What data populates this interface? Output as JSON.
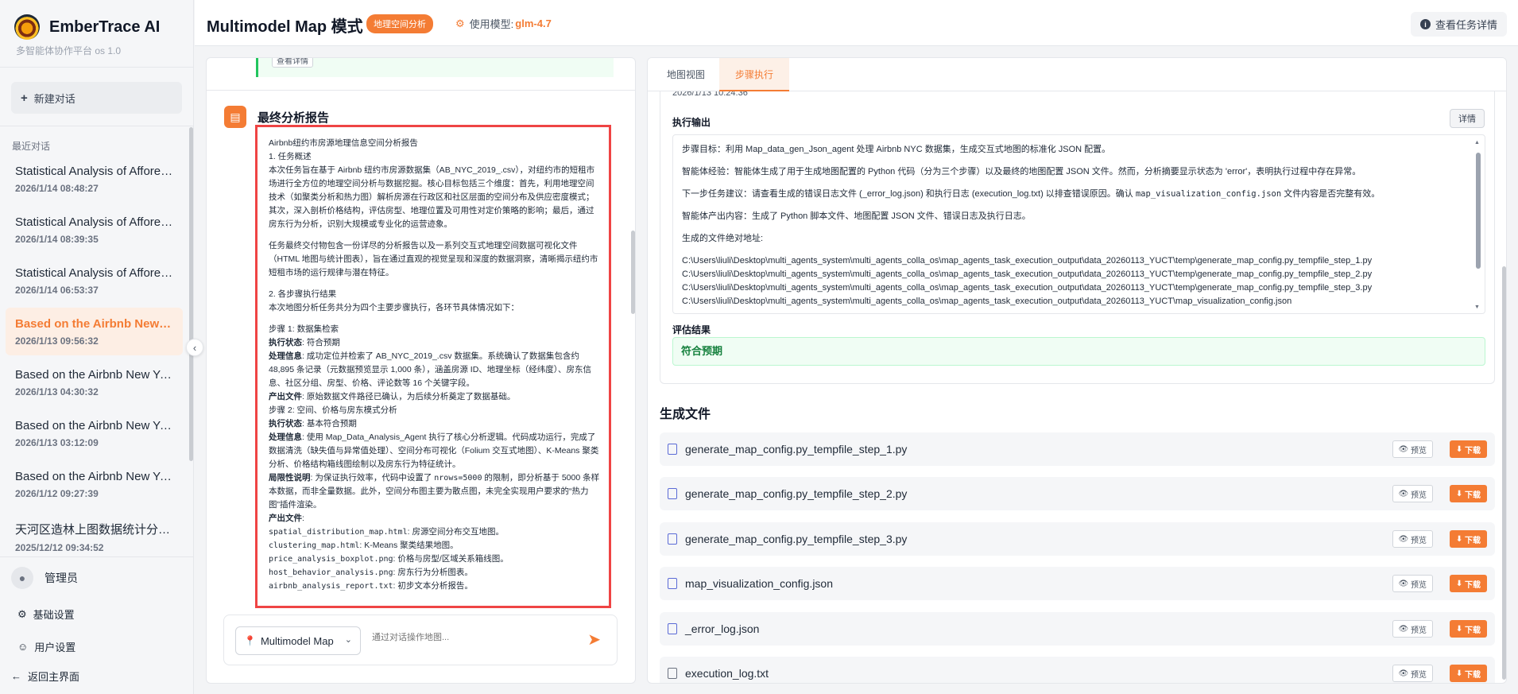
{
  "sidebar": {
    "brand_name": "EmberTrace AI",
    "brand_sub": "多智能体协作平台 os 1.0",
    "new_chat": "新建对话",
    "recent_label": "最近对话",
    "conversations": [
      {
        "title": "Statistical Analysis of Afforestation...",
        "time": "2026/1/14 08:48:27"
      },
      {
        "title": "Statistical Analysis of Afforestation...",
        "time": "2026/1/14 08:39:35"
      },
      {
        "title": "Statistical Analysis of Afforestation...",
        "time": "2026/1/14 06:53:37"
      },
      {
        "title": "Based on the Airbnb New York...",
        "time": "2026/1/13 09:56:32"
      },
      {
        "title": "Based on the Airbnb New York...",
        "time": "2026/1/13 04:30:32"
      },
      {
        "title": "Based on the Airbnb New York...",
        "time": "2026/1/13 03:12:09"
      },
      {
        "title": "Based on the Airbnb New York...",
        "time": "2026/1/12 09:27:39"
      },
      {
        "title": "天河区造林上图数据统计分析及...",
        "time": "2025/12/12 09:34:52"
      }
    ],
    "admin": "管理员",
    "basic_settings": "基础设置",
    "user_settings": "用户设置",
    "back_main": "返回主界面"
  },
  "header": {
    "title": "Multimodel Map 模式",
    "badge": "地理空间分析",
    "model_label": "使用模型:",
    "model_value": "glm-4.7",
    "task_detail": "查看任务详情"
  },
  "chat": {
    "prev_button": "查看详情",
    "report_title": "最终分析报告",
    "report": {
      "title": "Airbnb纽约市房源地理信息空间分析报告",
      "s1": "1. 任务概述",
      "p1": "本次任务旨在基于 Airbnb 纽约市房源数据集（AB_NYC_2019_.csv），对纽约市的短租市场进行全方位的地理空间分析与数据挖掘。核心目标包括三个维度：首先，利用地理空间技术（如聚类分析和热力图）解析房源在行政区和社区层面的空间分布及供应密度模式；其次，深入剖析价格结构，评估房型、地理位置及可用性对定价策略的影响；最后，通过房东行为分析，识别大规模或专业化的运营迹象。",
      "p2": "任务最终交付物包含一份详尽的分析报告以及一系列交互式地理空间数据可视化文件（HTML 地图与统计图表），旨在通过直观的视觉呈现和深度的数据洞察，清晰揭示纽约市短租市场的运行规律与潜在特征。",
      "s2": "2. 各步骤执行结果",
      "p3": "本次地图分析任务共分为四个主要步骤执行，各环节具体情况如下：",
      "step1": "步骤 1: 数据集检索",
      "k_status": "执行状态",
      "step1_status": ": 符合预期",
      "k_info": "处理信息",
      "step1_info": ": 成功定位并检索了 AB_NYC_2019_.csv 数据集。系统确认了数据集包含约 48,895 条记录（元数据预览显示 1,000 条），涵盖房源 ID、地理坐标（经纬度）、房东信息、社区分组、房型、价格、评论数等 16 个关键字段。",
      "k_output": "产出文件",
      "step1_output": ": 原始数据文件路径已确认，为后续分析奠定了数据基础。",
      "step2": "步骤 2: 空间、价格与房东模式分析",
      "step2_status": ": 基本符合预期",
      "step2_info": ": 使用 Map_Data_Analysis_Agent 执行了核心分析逻辑。代码成功运行，完成了数据清洗（缺失值与异常值处理）、空间分布可视化（Folium 交互式地图）、K-Means 聚类分析、价格结构箱线图绘制以及房东行为特征统计。",
      "k_limit": "局限性说明",
      "step2_limit_a": ": 为保证执行效率，代码中设置了 ",
      "step2_limit_code": "nrows=5000",
      "step2_limit_b": " 的限制，即分析基于 5000 条样本数据，而非全量数据。此外，空间分布图主要为散点图，未完全实现用户要求的“热力图”插件渲染。",
      "k_output2": "产出文件",
      "files": [
        {
          "name": "spatial_distribution_map.html",
          "desc": ": 房源空间分布交互地图。"
        },
        {
          "name": "clustering_map.html",
          "desc": ": K-Means 聚类结果地图。"
        },
        {
          "name": "price_analysis_boxplot.png",
          "desc": ": 价格与房型/区域关系箱线图。"
        },
        {
          "name": "host_behavior_analysis.png",
          "desc": ": 房东行为分析图表。"
        },
        {
          "name": "airbnb_analysis_report.txt",
          "desc": ": 初步文本分析报告。"
        }
      ]
    },
    "mode": "Multimodel Map",
    "input_placeholder": "通过对话操作地图..."
  },
  "right": {
    "tabs": [
      "地图视图",
      "步骤执行"
    ],
    "step_time": "2026/1/13 10:24:36",
    "exec_label": "执行输出",
    "detail_btn": "详情",
    "output": {
      "goal": "步骤目标：利用 Map_data_gen_Json_agent 处理 Airbnb NYC 数据集，生成交互式地图的标准化 JSON 配置。",
      "exp": "智能体经验：智能体生成了用于生成地图配置的 Python 代码（分为三个步骤）以及最终的地图配置 JSON 文件。然而，分析摘要显示状态为 'error'，表明执行过程中存在异常。",
      "next_a": "下一步任务建议：请查看生成的错误日志文件 (_error_log.json) 和执行日志 (execution_log.txt) 以排查错误原因。确认 ",
      "next_code": "map_visualization_config.json",
      "next_b": " 文件内容是否完整有效。",
      "produced": "智能体产出内容：生成了 Python 脚本文件、地图配置 JSON 文件、错误日志及执行日志。",
      "paths_label": "生成的文件绝对地址:",
      "paths": [
        "C:\\Users\\liuli\\Desktop\\multi_agents_system\\multi_agents_colla_os\\map_agents_task_execution_output\\data_20260113_YUCT\\temp\\generate_map_config.py_tempfile_step_1.py",
        "C:\\Users\\liuli\\Desktop\\multi_agents_system\\multi_agents_colla_os\\map_agents_task_execution_output\\data_20260113_YUCT\\temp\\generate_map_config.py_tempfile_step_2.py",
        "C:\\Users\\liuli\\Desktop\\multi_agents_system\\multi_agents_colla_os\\map_agents_task_execution_output\\data_20260113_YUCT\\temp\\generate_map_config.py_tempfile_step_3.py",
        "C:\\Users\\liuli\\Desktop\\multi_agents_system\\multi_agents_colla_os\\map_agents_task_execution_output\\data_20260113_YUCT\\map_visualization_config.json"
      ]
    },
    "eval_label": "评估结果",
    "eval_value": "符合预期",
    "files_title": "生成文件",
    "preview": "预览",
    "download": "下载",
    "files": [
      {
        "name": "generate_map_config.py_tempfile_step_1.py"
      },
      {
        "name": "generate_map_config.py_tempfile_step_2.py"
      },
      {
        "name": "generate_map_config.py_tempfile_step_3.py"
      },
      {
        "name": "map_visualization_config.json"
      },
      {
        "name": "_error_log.json"
      },
      {
        "name": "execution_log.txt"
      }
    ]
  }
}
